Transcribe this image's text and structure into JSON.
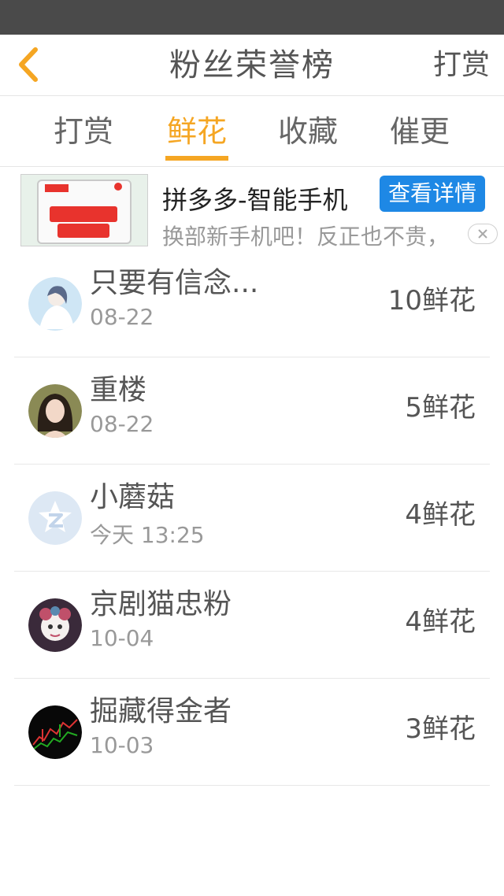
{
  "nav": {
    "title": "粉丝荣誉榜",
    "action_label": "打赏"
  },
  "tabs": [
    {
      "label": "打赏",
      "active": false
    },
    {
      "label": "鲜花",
      "active": true
    },
    {
      "label": "收藏",
      "active": false
    },
    {
      "label": "催更",
      "active": false
    }
  ],
  "ad": {
    "title": "拼多多-智能手机",
    "button_label": "查看详情",
    "subtitle": "换部新手机吧！反正也不贵，",
    "close_icon": "close-icon"
  },
  "fans": [
    {
      "name": "只要有信念...",
      "date": "08-22",
      "amount": "10鲜花",
      "avatar": "avatar-anime-girl-white"
    },
    {
      "name": "重楼",
      "date": "08-22",
      "amount": "5鲜花",
      "avatar": "avatar-girl-dark-hair"
    },
    {
      "name": "小蘑菇",
      "date": "今天 13:25",
      "amount": "4鲜花",
      "avatar": "avatar-default-z"
    },
    {
      "name": "京剧猫忠粉",
      "date": "10-04",
      "amount": "4鲜花",
      "avatar": "avatar-opera-cat"
    },
    {
      "name": "掘藏得金者",
      "date": "10-03",
      "amount": "3鲜花",
      "avatar": "avatar-stock-chart"
    }
  ],
  "colors": {
    "accent": "#f5a623",
    "ad_button": "#1e88e5",
    "status_bar": "#4a4a4a"
  }
}
